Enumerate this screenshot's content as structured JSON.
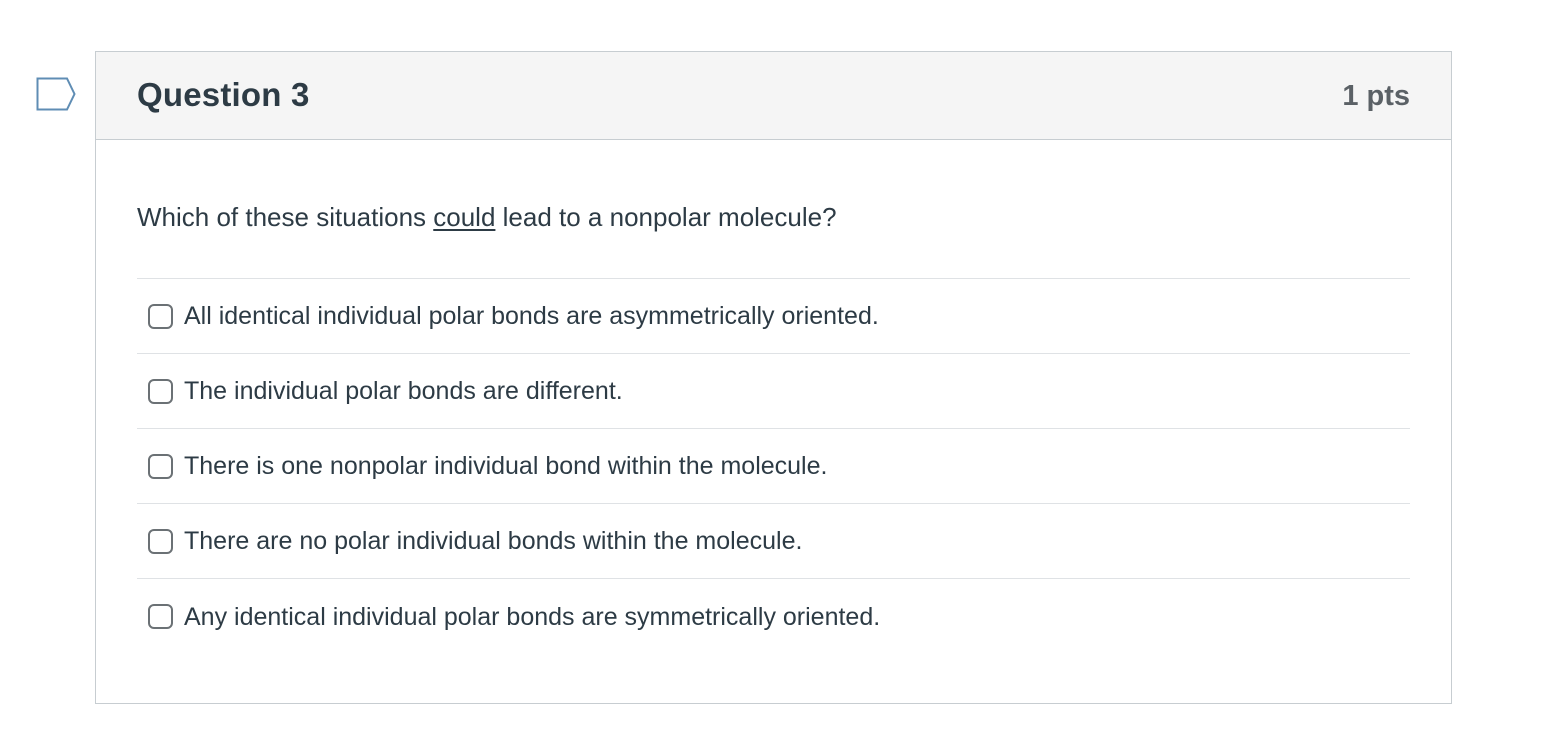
{
  "question": {
    "title": "Question 3",
    "points": "1 pts",
    "text_before": "Which of these situations ",
    "text_emphasis": "could",
    "text_after": " lead to a nonpolar molecule?",
    "flag_icon": "flag-outline-icon",
    "answers": [
      {
        "label": "All identical individual polar bonds are asymmetrically oriented.",
        "checked": false
      },
      {
        "label": "The individual polar bonds are different.",
        "checked": false
      },
      {
        "label": "There is one nonpolar individual bond within the molecule.",
        "checked": false
      },
      {
        "label": "There are no polar individual bonds within the molecule.",
        "checked": false
      },
      {
        "label": "Any identical individual polar bonds are symmetrically oriented.",
        "checked": false
      }
    ]
  },
  "colors": {
    "header_bg": "#f5f5f5",
    "border": "#c7cdd1",
    "text": "#2d3b45",
    "points_text": "#5b6166",
    "flag_stroke": "#5f8db4"
  }
}
